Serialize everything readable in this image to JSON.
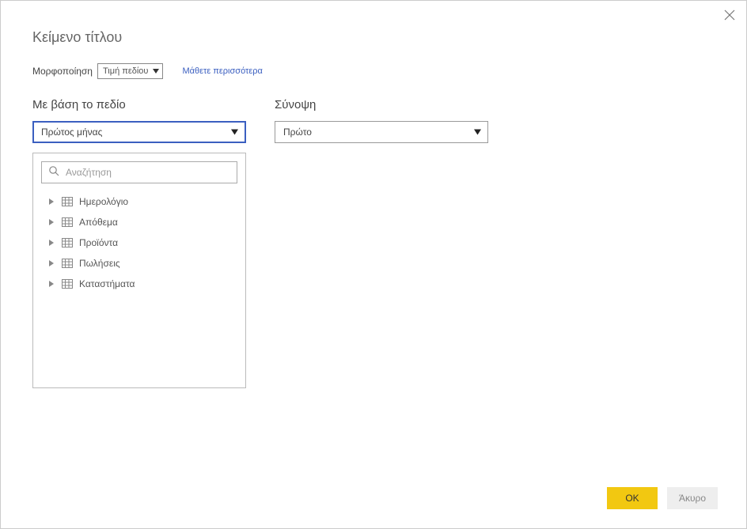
{
  "dialog": {
    "title": "Κείμενο τίτλου"
  },
  "formatRow": {
    "label": "Μορφοποίηση",
    "selectValue": "Τιμή πεδίου",
    "learnMore": "Μάθετε περισσότερα"
  },
  "fieldSection": {
    "label": "Με βάση το πεδίο",
    "selected": "Πρώτος μήνας",
    "searchPlaceholder": "Αναζήτηση",
    "tables": [
      {
        "name": "Ημερολόγιο"
      },
      {
        "name": "Απόθεμα"
      },
      {
        "name": "Προϊόντα"
      },
      {
        "name": "Πωλήσεις"
      },
      {
        "name": "Καταστήματα"
      }
    ]
  },
  "summarySection": {
    "label": "Σύνοψη",
    "selected": "Πρώτο"
  },
  "footer": {
    "ok": "OK",
    "cancel": "Άκυρο"
  }
}
